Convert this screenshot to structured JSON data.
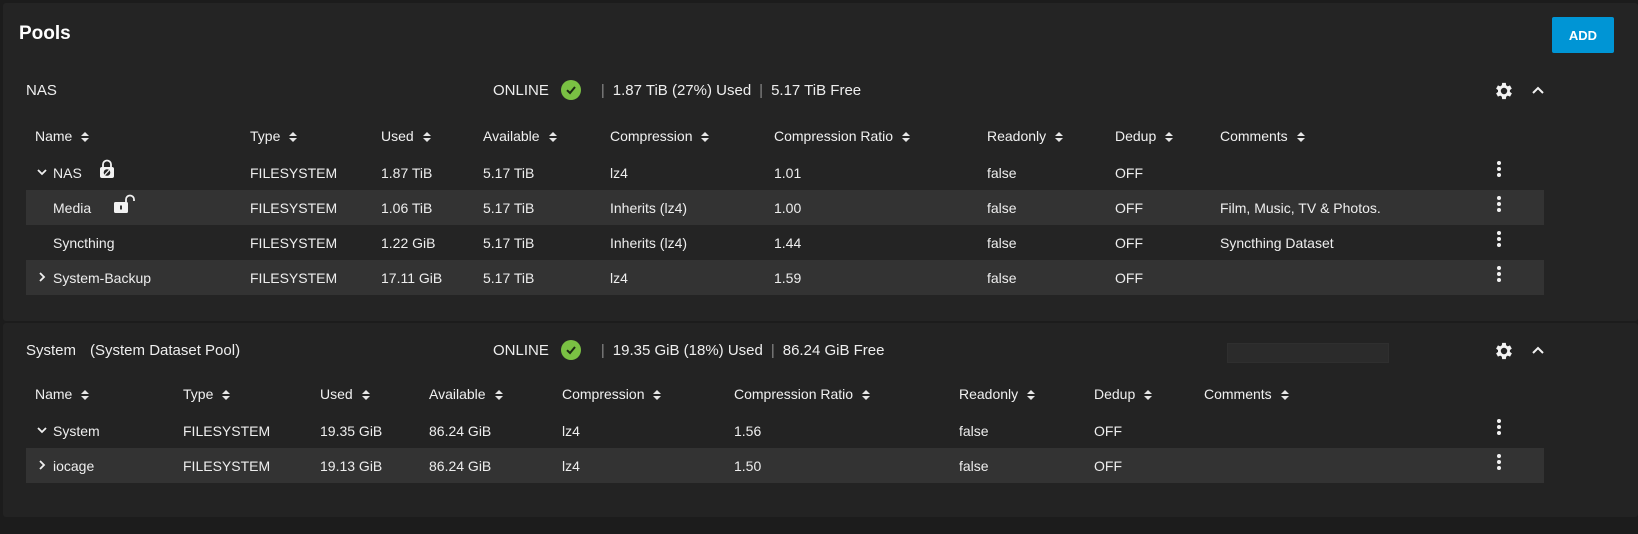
{
  "page": {
    "title": "Pools",
    "add_label": "ADD"
  },
  "pools": [
    {
      "name": "NAS",
      "subtitle": "",
      "status": "ONLINE",
      "used": "1.87 TiB (27%) Used",
      "free": "5.17 TiB Free",
      "columns": [
        "Name",
        "Type",
        "Used",
        "Available",
        "Compression",
        "Compression Ratio",
        "Readonly",
        "Dedup",
        "Comments"
      ],
      "rows": [
        {
          "name": "NAS",
          "expander": "expanded",
          "lock": "locked",
          "type": "FILESYSTEM",
          "used": "1.87 TiB",
          "available": "5.17 TiB",
          "compression": "lz4",
          "ratio": "1.01",
          "readonly": "false",
          "dedup": "OFF",
          "comments": ""
        },
        {
          "name": "Media",
          "expander": "none",
          "lock": "unlocked",
          "type": "FILESYSTEM",
          "used": "1.06 TiB",
          "available": "5.17 TiB",
          "compression": "Inherits (lz4)",
          "ratio": "1.00",
          "readonly": "false",
          "dedup": "OFF",
          "comments": "Film, Music, TV & Photos."
        },
        {
          "name": "Syncthing",
          "expander": "none",
          "lock": "none",
          "type": "FILESYSTEM",
          "used": "1.22 GiB",
          "available": "5.17 TiB",
          "compression": "Inherits (lz4)",
          "ratio": "1.44",
          "readonly": "false",
          "dedup": "OFF",
          "comments": "Syncthing Dataset"
        },
        {
          "name": "System-Backup",
          "expander": "collapsed",
          "lock": "none",
          "type": "FILESYSTEM",
          "used": "17.11 GiB",
          "available": "5.17 TiB",
          "compression": "lz4",
          "ratio": "1.59",
          "readonly": "false",
          "dedup": "OFF",
          "comments": ""
        }
      ]
    },
    {
      "name": "System",
      "subtitle": "(System Dataset Pool)",
      "status": "ONLINE",
      "used": "19.35 GiB (18%) Used",
      "free": "86.24 GiB Free",
      "columns": [
        "Name",
        "Type",
        "Used",
        "Available",
        "Compression",
        "Compression Ratio",
        "Readonly",
        "Dedup",
        "Comments"
      ],
      "rows": [
        {
          "name": "System",
          "expander": "expanded",
          "lock": "none",
          "type": "FILESYSTEM",
          "used": "19.35 GiB",
          "available": "86.24 GiB",
          "compression": "lz4",
          "ratio": "1.56",
          "readonly": "false",
          "dedup": "OFF",
          "comments": ""
        },
        {
          "name": "iocage",
          "expander": "collapsed",
          "lock": "none",
          "type": "FILESYSTEM",
          "used": "19.13 GiB",
          "available": "86.24 GiB",
          "compression": "lz4",
          "ratio": "1.50",
          "readonly": "false",
          "dedup": "OFF",
          "comments": ""
        }
      ]
    }
  ],
  "colors": {
    "accent": "#0095d5",
    "status_ok": "#7ac143",
    "row_alt": "#333333",
    "card": "#242424"
  },
  "icons": {
    "status": "check-circle-icon",
    "settings": "gear-icon",
    "collapse": "chevron-up-icon",
    "row_menu": "more-vert-icon",
    "sort": "sort-icon"
  }
}
